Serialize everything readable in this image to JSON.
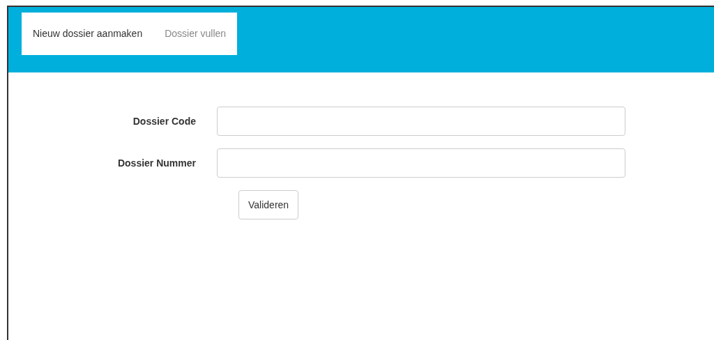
{
  "nav": {
    "tabs": [
      {
        "label": "Nieuw dossier aanmaken",
        "selected": true
      },
      {
        "label": "Dossier vullen",
        "selected": false
      }
    ]
  },
  "form": {
    "fields": [
      {
        "label": "Dossier Code"
      },
      {
        "label": "Dossier Nummer"
      }
    ],
    "button": "Valideren"
  }
}
